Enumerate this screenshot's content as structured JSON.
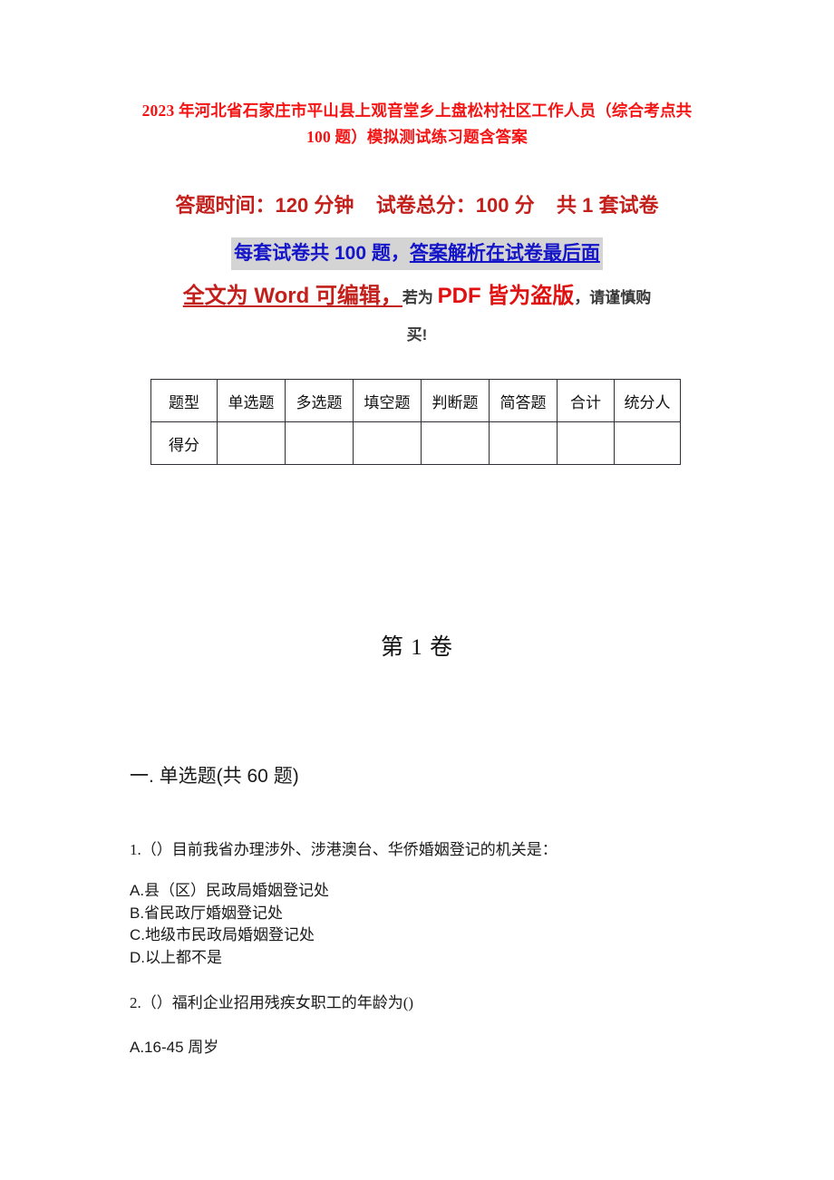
{
  "document": {
    "title": "2023 年河北省石家庄市平山县上观音堂乡上盘松村社区工作人员（综合考点共 100 题）模拟测试练习题含答案",
    "colors": {
      "title_red": "#f41414",
      "info_dark_red": "#c3201c",
      "info_blue": "#1414c8",
      "highlight_gray": "#d4d4d4",
      "pdf_red": "#e01010",
      "body_text": "#1a1a1a",
      "table_border": "#2e2e36"
    }
  },
  "info": {
    "line1": "答题时间：120 分钟    试卷总分：100 分    共 1 套试卷",
    "line2_plain": "每套试卷共 100 题，",
    "line2_underlined": "答案解析在试卷最后面",
    "line3_word": "全文为 Word 可编辑，",
    "line3_plain1": "若为 ",
    "line3_pdf": "PDF 皆为盗版",
    "line3_plain2": "，请谨慎购",
    "line4": "买!"
  },
  "score_table": {
    "headers": [
      "题型",
      "单选题",
      "多选题",
      "填空题",
      "判断题",
      "简答题",
      "合计",
      "统分人"
    ],
    "rows": [
      {
        "label": "得分",
        "cells": [
          "",
          "",
          "",
          "",
          "",
          "",
          ""
        ]
      }
    ]
  },
  "volume": {
    "heading": "第 1 卷"
  },
  "sections": [
    {
      "heading": "一. 单选题(共 60 题)",
      "questions": [
        {
          "stem": "1.（）目前我省办理涉外、涉港澳台、华侨婚姻登记的机关是：",
          "options": [
            "A.县（区）民政局婚姻登记处",
            "B.省民政厅婚姻登记处",
            "C.地级市民政局婚姻登记处",
            "D.以上都不是"
          ]
        },
        {
          "stem": "2.（）福利企业招用残疾女职工的年龄为()",
          "options": [
            "A.16-45 周岁"
          ]
        }
      ]
    }
  ]
}
